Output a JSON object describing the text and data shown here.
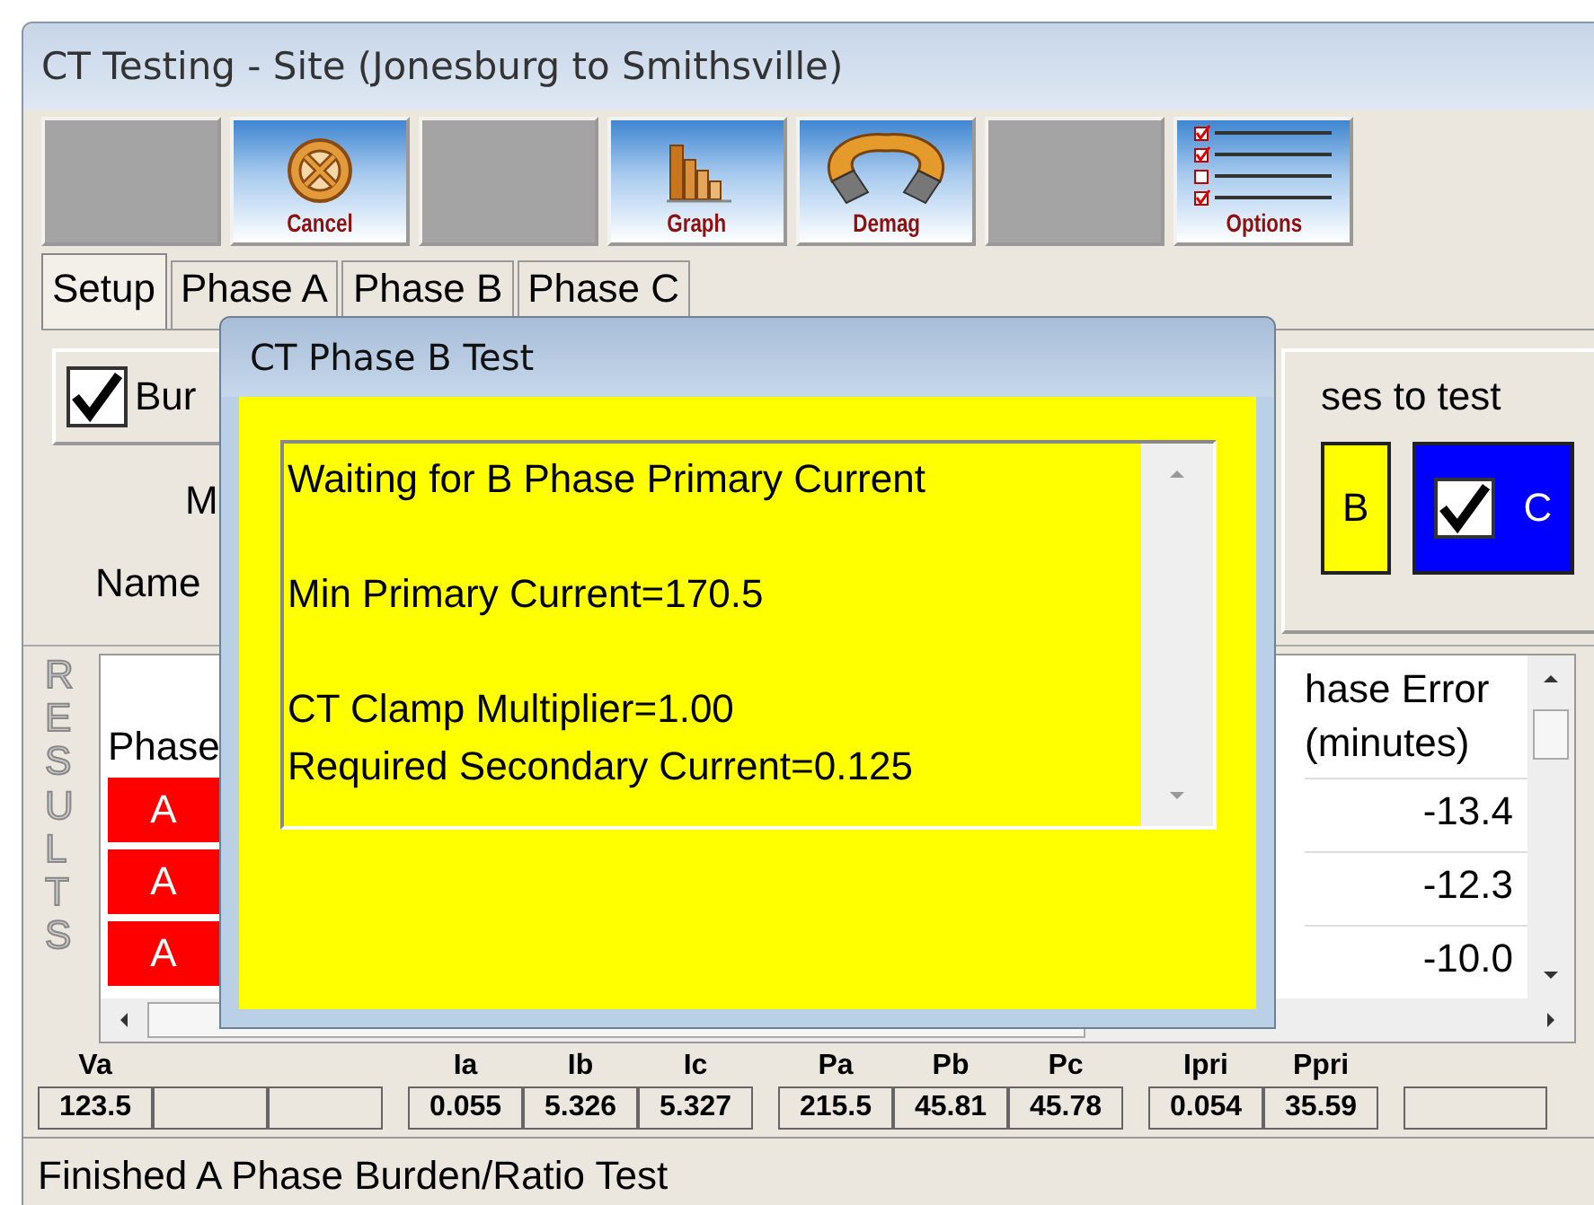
{
  "window": {
    "title": "CT Testing - Site (Jonesburg to Smithsville)"
  },
  "toolbar": [
    {
      "kind": "blank"
    },
    {
      "kind": "cancel",
      "label": "Cancel"
    },
    {
      "kind": "blank"
    },
    {
      "kind": "graph",
      "label": "Graph"
    },
    {
      "kind": "demag",
      "label": "Demag"
    },
    {
      "kind": "blank"
    },
    {
      "kind": "options",
      "label": "Options"
    }
  ],
  "tabs": [
    {
      "label": "Setup",
      "selected": true
    },
    {
      "label": "Phase A",
      "selected": false
    },
    {
      "label": "Phase B",
      "selected": false
    },
    {
      "label": "Phase C",
      "selected": false
    }
  ],
  "setup": {
    "burden_checkbox": {
      "label": "Bur",
      "checked": true
    },
    "label_1": "M",
    "label_2": "Name",
    "phases_group": {
      "title": "ses to test",
      "phases": [
        {
          "label": "B",
          "color": "#ffff00"
        },
        {
          "label": "C",
          "checked": true,
          "color": "#0000ff"
        }
      ]
    }
  },
  "results": {
    "side_label": "RESULTS",
    "column_1": "Phase",
    "column_2": [
      "hase Error",
      "(minutes)"
    ],
    "rows": [
      {
        "phase": "A",
        "phase_error": "-13.4"
      },
      {
        "phase": "A",
        "phase_error": "-12.3"
      },
      {
        "phase": "A",
        "phase_error": "-10.0"
      }
    ]
  },
  "readings": [
    {
      "cells": [
        {
          "label": "Va",
          "value": "123.5"
        },
        {},
        {}
      ]
    },
    {
      "cells": [
        {
          "label": "Ia",
          "value": "0.055"
        },
        {
          "label": "Ib",
          "value": "5.326"
        },
        {
          "label": "Ic",
          "value": "5.327"
        }
      ]
    },
    {
      "cells": [
        {
          "label": "Pa",
          "value": "215.5"
        },
        {
          "label": "Pb",
          "value": "45.81"
        },
        {
          "label": "Pc",
          "value": "45.78"
        }
      ]
    },
    {
      "cells": [
        {
          "label": "Ipri",
          "value": "0.054"
        },
        {
          "label": "Ppri",
          "value": "35.59"
        }
      ]
    },
    {
      "cells": [
        {}
      ]
    }
  ],
  "status_bar": "Finished A Phase Burden/Ratio Test",
  "dialog": {
    "title": "CT Phase B Test",
    "paragraphs": [
      [
        "Waiting for B Phase Primary Current"
      ],
      [
        "Min Primary Current=170.5"
      ],
      [
        "CT Clamp Multiplier=1.00",
        "Required Secondary Current=0.125"
      ]
    ]
  }
}
